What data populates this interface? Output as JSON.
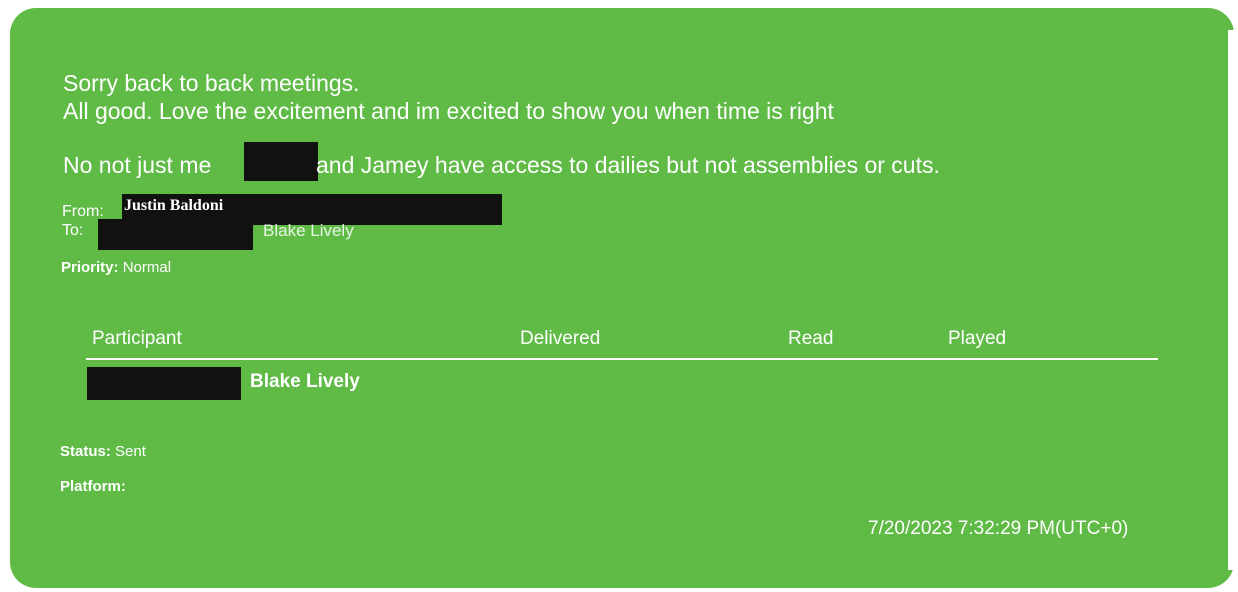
{
  "message": {
    "line1": "Sorry back to back meetings.",
    "line2": "All good. Love the excitement and im excited to show you when time is right",
    "line3_part1": "No not just me",
    "line3_part2": "and Jamey have access to dailies but not assemblies or cuts."
  },
  "header": {
    "from_label": "From:",
    "from_name": "Justin Baldoni",
    "to_label": "To:",
    "to_name": "Blake Lively",
    "priority_label": "Priority:",
    "priority_value": "Normal"
  },
  "table": {
    "columns": [
      "Participant",
      "Delivered",
      "Read",
      "Played"
    ],
    "rows": [
      {
        "participant": "Blake Lively"
      }
    ]
  },
  "status": {
    "status_label": "Status:",
    "status_value": "Sent",
    "platform_label": "Platform:"
  },
  "timestamp": "7/20/2023 7:32:29 PM(UTC+0)",
  "colors": {
    "bubble": "#5fbb46",
    "text": "#ffffff",
    "redaction": "#111111"
  }
}
